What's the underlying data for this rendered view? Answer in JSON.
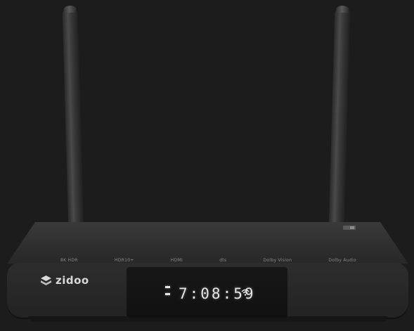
{
  "device": {
    "brand": "zidoo",
    "clock": "7:08:59"
  },
  "badges": [
    "8K HDR",
    "HDR10+",
    "HDMI",
    "dts",
    "Dolby Vision",
    "Dolby Audio"
  ],
  "colors": {
    "background": "#1c1c1c",
    "device_body": "#2e2e2e",
    "display_text": "#e6e6e6"
  },
  "icons": {
    "brand": "zidoo-logo-icon",
    "wifi": "wifi-icon",
    "indicator": "status-indicator-icon"
  }
}
